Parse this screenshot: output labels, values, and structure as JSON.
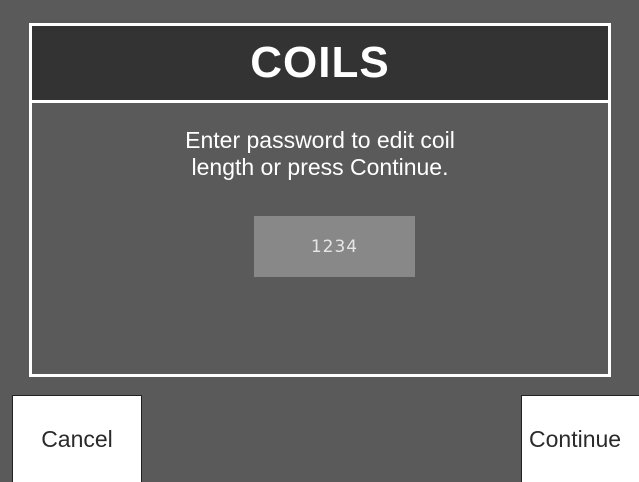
{
  "dialog": {
    "title": "COILS",
    "message_line1": "Enter password to edit coil",
    "message_line2": "length or press Continue.",
    "password_value": "1234"
  },
  "buttons": {
    "cancel_label": "Cancel",
    "continue_label": "Continue"
  },
  "colors": {
    "background": "#5a5a5a",
    "header": "#333333",
    "field": "#888888",
    "border": "#ffffff",
    "button": "#ffffff"
  }
}
